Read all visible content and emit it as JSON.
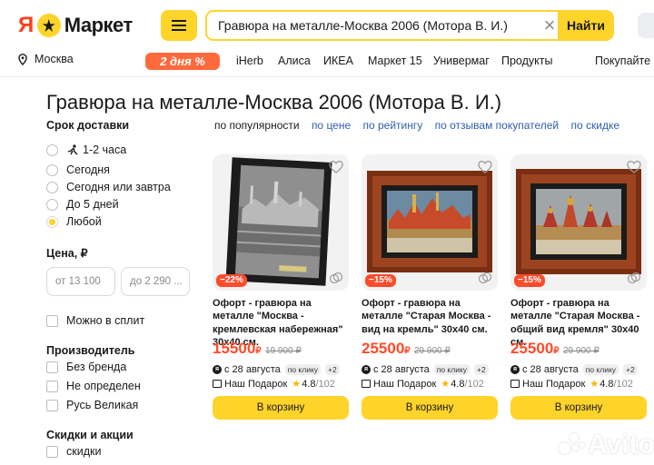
{
  "header": {
    "logo_ya": "Я",
    "logo_text": "Маркет",
    "search_value": "Гравюра на металле-Москва 2006 (Мотора В. И.)",
    "search_button": "Найти",
    "clear_icon": "close-icon",
    "menu_icon": "hamburger-icon"
  },
  "nav": {
    "location": "Москва",
    "promo_badge": "2 дня %",
    "items": [
      "iHerb",
      "Алиса",
      "ИКЕА",
      "Маркет 15",
      "Универмаг",
      "Продукты",
      "Покупайте к"
    ]
  },
  "page_title": "Гравюра на металле-Москва 2006 (Мотора В. И.)",
  "filters": {
    "delivery_title": "Срок доставки",
    "delivery_options": [
      "1-2 часа",
      "Сегодня",
      "Сегодня или завтра",
      "До 5 дней",
      "Любой"
    ],
    "price_title": "Цена, ₽",
    "price_from": "от 13 100",
    "price_to": "до 2 290 ...",
    "split_label": "Можно в сплит",
    "manufacturer_title": "Производитель",
    "manufacturers": [
      "Без бренда",
      "Не определен",
      "Русь Великая"
    ],
    "discounts_title": "Скидки и акции",
    "discounts": [
      "скидки"
    ]
  },
  "sort": {
    "options": [
      "по популярности",
      "по цене",
      "по рейтингу",
      "по отзывам покупателей",
      "по скидке"
    ]
  },
  "products": [
    {
      "title": "Офорт - гравюра на металле \"Москва - кремлевская набережная\" 30х40 см.",
      "price": "15500",
      "currency": "₽",
      "old_price": "19 900 ₽",
      "discount": "−22%",
      "delivery": "с 28 августа",
      "delivery_chip": "по клику",
      "delivery_plus": "+2",
      "seller": "Наш Подарок",
      "rating": "4.8",
      "reviews": "/102",
      "cart_button": "В корзину"
    },
    {
      "title": "Офорт - гравюра на металле \"Старая Москва - вид на кремль\" 30х40 см.",
      "price": "25500",
      "currency": "₽",
      "old_price": "29 900 ₽",
      "discount": "−15%",
      "delivery": "с 28 августа",
      "delivery_chip": "по клику",
      "delivery_plus": "+2",
      "seller": "Наш Подарок",
      "rating": "4.8",
      "reviews": "/102",
      "cart_button": "В корзину"
    },
    {
      "title": "Офорт - гравюра на металле \"Старая Москва - общий вид кремля\" 30х40 см.",
      "price": "25500",
      "currency": "₽",
      "old_price": "29 900 ₽",
      "discount": "−15%",
      "delivery": "с 28 августа",
      "delivery_chip": "по клику",
      "delivery_plus": "+2",
      "seller": "Наш Подарок",
      "rating": "4.8",
      "reviews": "/102",
      "cart_button": "В корзину"
    }
  ],
  "watermark": "Avito",
  "colors": {
    "accent_yellow": "#fed42b",
    "price_red": "#ff4b2b",
    "link_blue": "#2e5fb0",
    "promo_orange": "#ff6a3d"
  }
}
